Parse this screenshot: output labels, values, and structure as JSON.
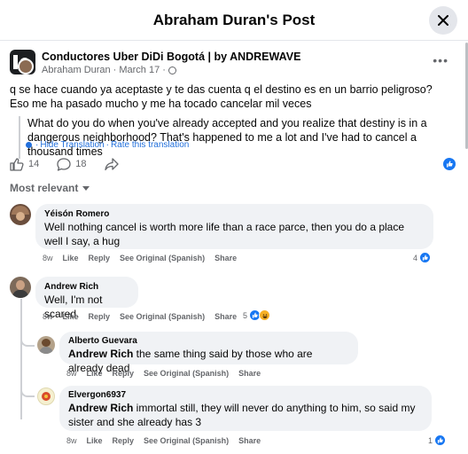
{
  "header": {
    "title": "Abraham Duran's Post"
  },
  "post": {
    "group_name": "Conductores Uber DiDi Bogotá | by ANDREWAVE",
    "author": "Abraham Duran",
    "date": "March 17",
    "separator": "·",
    "text": "q se hace cuando ya aceptaste y te das cuenta q el destino es en un barrio peligroso? Eso me ha pasado mucho y me ha tocado cancelar mil veces",
    "translation": "What do you do when you've already accepted and you realize that destiny is in a dangerous neighborhood? That's happened to me a lot and I've had to cancel a thousand times",
    "hide_translation": "Hide Translation",
    "rate_translation": "Rate this translation",
    "like_count": "14",
    "comment_count": "18"
  },
  "sort_label": "Most relevant",
  "comments": [
    {
      "name": "Yéisón Romero",
      "text": "Well nothing cancel is worth more life than a race parce, then you do a place well I say, a hug",
      "time": "8w",
      "like": "Like",
      "reply": "Reply",
      "see_original": "See Original (Spanish)",
      "share": "Share",
      "reactions": "4"
    },
    {
      "name": "Andrew Rich",
      "text": "Well, I'm not scared.",
      "time": "8w",
      "like": "Like",
      "reply": "Reply",
      "see_original": "See Original (Spanish)",
      "share": "Share",
      "reactions": "5"
    }
  ],
  "replies": [
    {
      "name": "Alberto Guevara",
      "mention": "Andrew Rich",
      "text": " the same thing said by those who are already dead",
      "time": "8w",
      "like": "Like",
      "reply": "Reply",
      "see_original": "See Original (Spanish)",
      "share": "Share"
    },
    {
      "name": "Elvergon6937",
      "mention": "Andrew Rich",
      "text": " immortal still, they will never do anything to him, so said my sister and she already has 3",
      "time": "8w",
      "like": "Like",
      "reply": "Reply",
      "see_original": "See Original (Spanish)",
      "share": "Share",
      "reactions": "1"
    }
  ],
  "colors": {
    "accent": "#1877f2",
    "link": "#216fdb",
    "muted": "#65676b",
    "bubble": "#f0f2f5"
  }
}
